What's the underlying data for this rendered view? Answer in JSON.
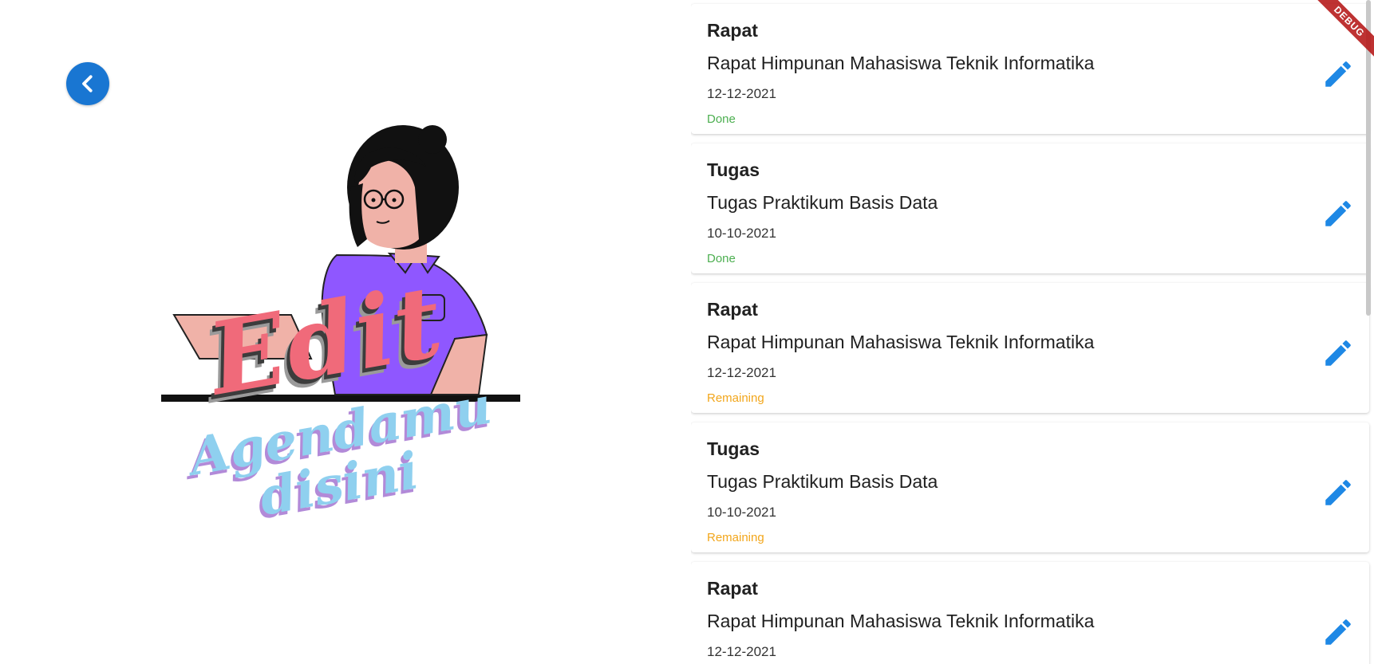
{
  "colors": {
    "accent": "#1976d2",
    "edit_icon": "#1e88e5",
    "done": "#4caf50",
    "remaining": "#f2a61b"
  },
  "illustration": {
    "title": "Edit",
    "subtitle_line1": "Agendamu",
    "subtitle_line2": "disini"
  },
  "debug_banner": "DEBUG",
  "agenda": [
    {
      "category": "Rapat",
      "title": "Rapat Himpunan Mahasiswa Teknik Informatika",
      "date": "12-12-2021",
      "status": "Done"
    },
    {
      "category": "Tugas",
      "title": "Tugas Praktikum Basis Data",
      "date": "10-10-2021",
      "status": "Done"
    },
    {
      "category": "Rapat",
      "title": "Rapat Himpunan Mahasiswa Teknik Informatika",
      "date": "12-12-2021",
      "status": "Remaining"
    },
    {
      "category": "Tugas",
      "title": "Tugas Praktikum Basis Data",
      "date": "10-10-2021",
      "status": "Remaining"
    },
    {
      "category": "Rapat",
      "title": "Rapat Himpunan Mahasiswa Teknik Informatika",
      "date": "12-12-2021",
      "status": ""
    }
  ]
}
